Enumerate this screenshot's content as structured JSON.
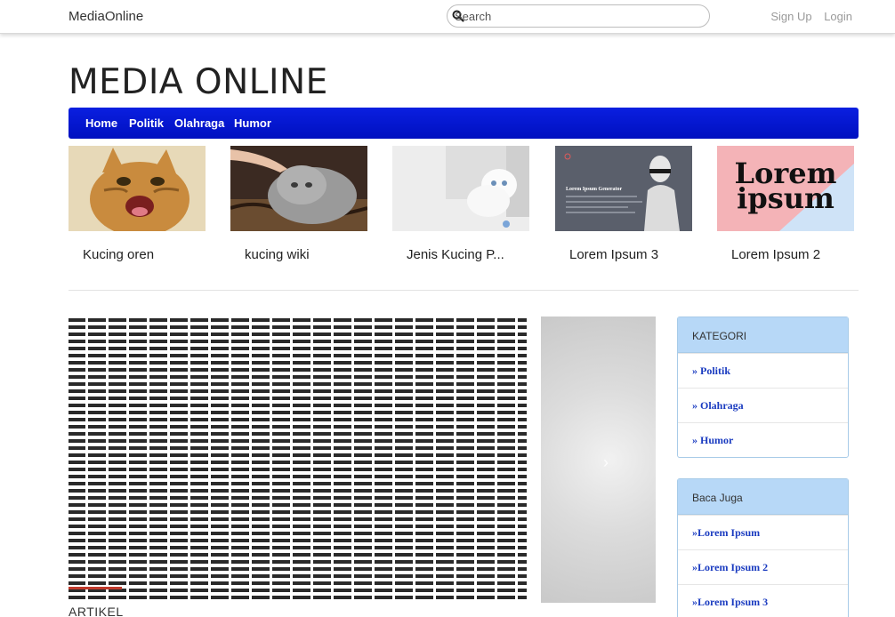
{
  "topbar": {
    "brand": "MediaOnline",
    "search_placeholder": "Search",
    "signup": "Sign Up",
    "login": "Login"
  },
  "site_title": "MEDIA ONLINE",
  "nav": [
    "Home",
    "Politik",
    "Olahraga",
    "Humor"
  ],
  "cards": [
    {
      "caption": "Kucing oren"
    },
    {
      "caption": "kucing wiki"
    },
    {
      "caption": "Jenis Kucing P..."
    },
    {
      "caption": "Lorem Ipsum 3",
      "thumb_title": "Lorem Ipsum Generator"
    },
    {
      "caption": "Lorem Ipsum 2",
      "thumb_line1": "Lorem",
      "thumb_line2": "ipsum"
    }
  ],
  "carousel": {
    "next_icon": "chevron-right-icon"
  },
  "section_label": "ARTIKEL",
  "sidebar": {
    "kategori": {
      "title": "KATEGORI",
      "items": [
        "» Politik",
        "» Olahraga",
        "» Humor"
      ]
    },
    "baca_juga": {
      "title": "Baca Juga",
      "items": [
        "»Lorem Ipsum",
        "»Lorem Ipsum 2",
        "»Lorem Ipsum 3"
      ]
    }
  },
  "colors": {
    "nav_blue": "#0a1fe0",
    "panel_head": "#b7d8f7",
    "link": "#1a3bc0"
  }
}
